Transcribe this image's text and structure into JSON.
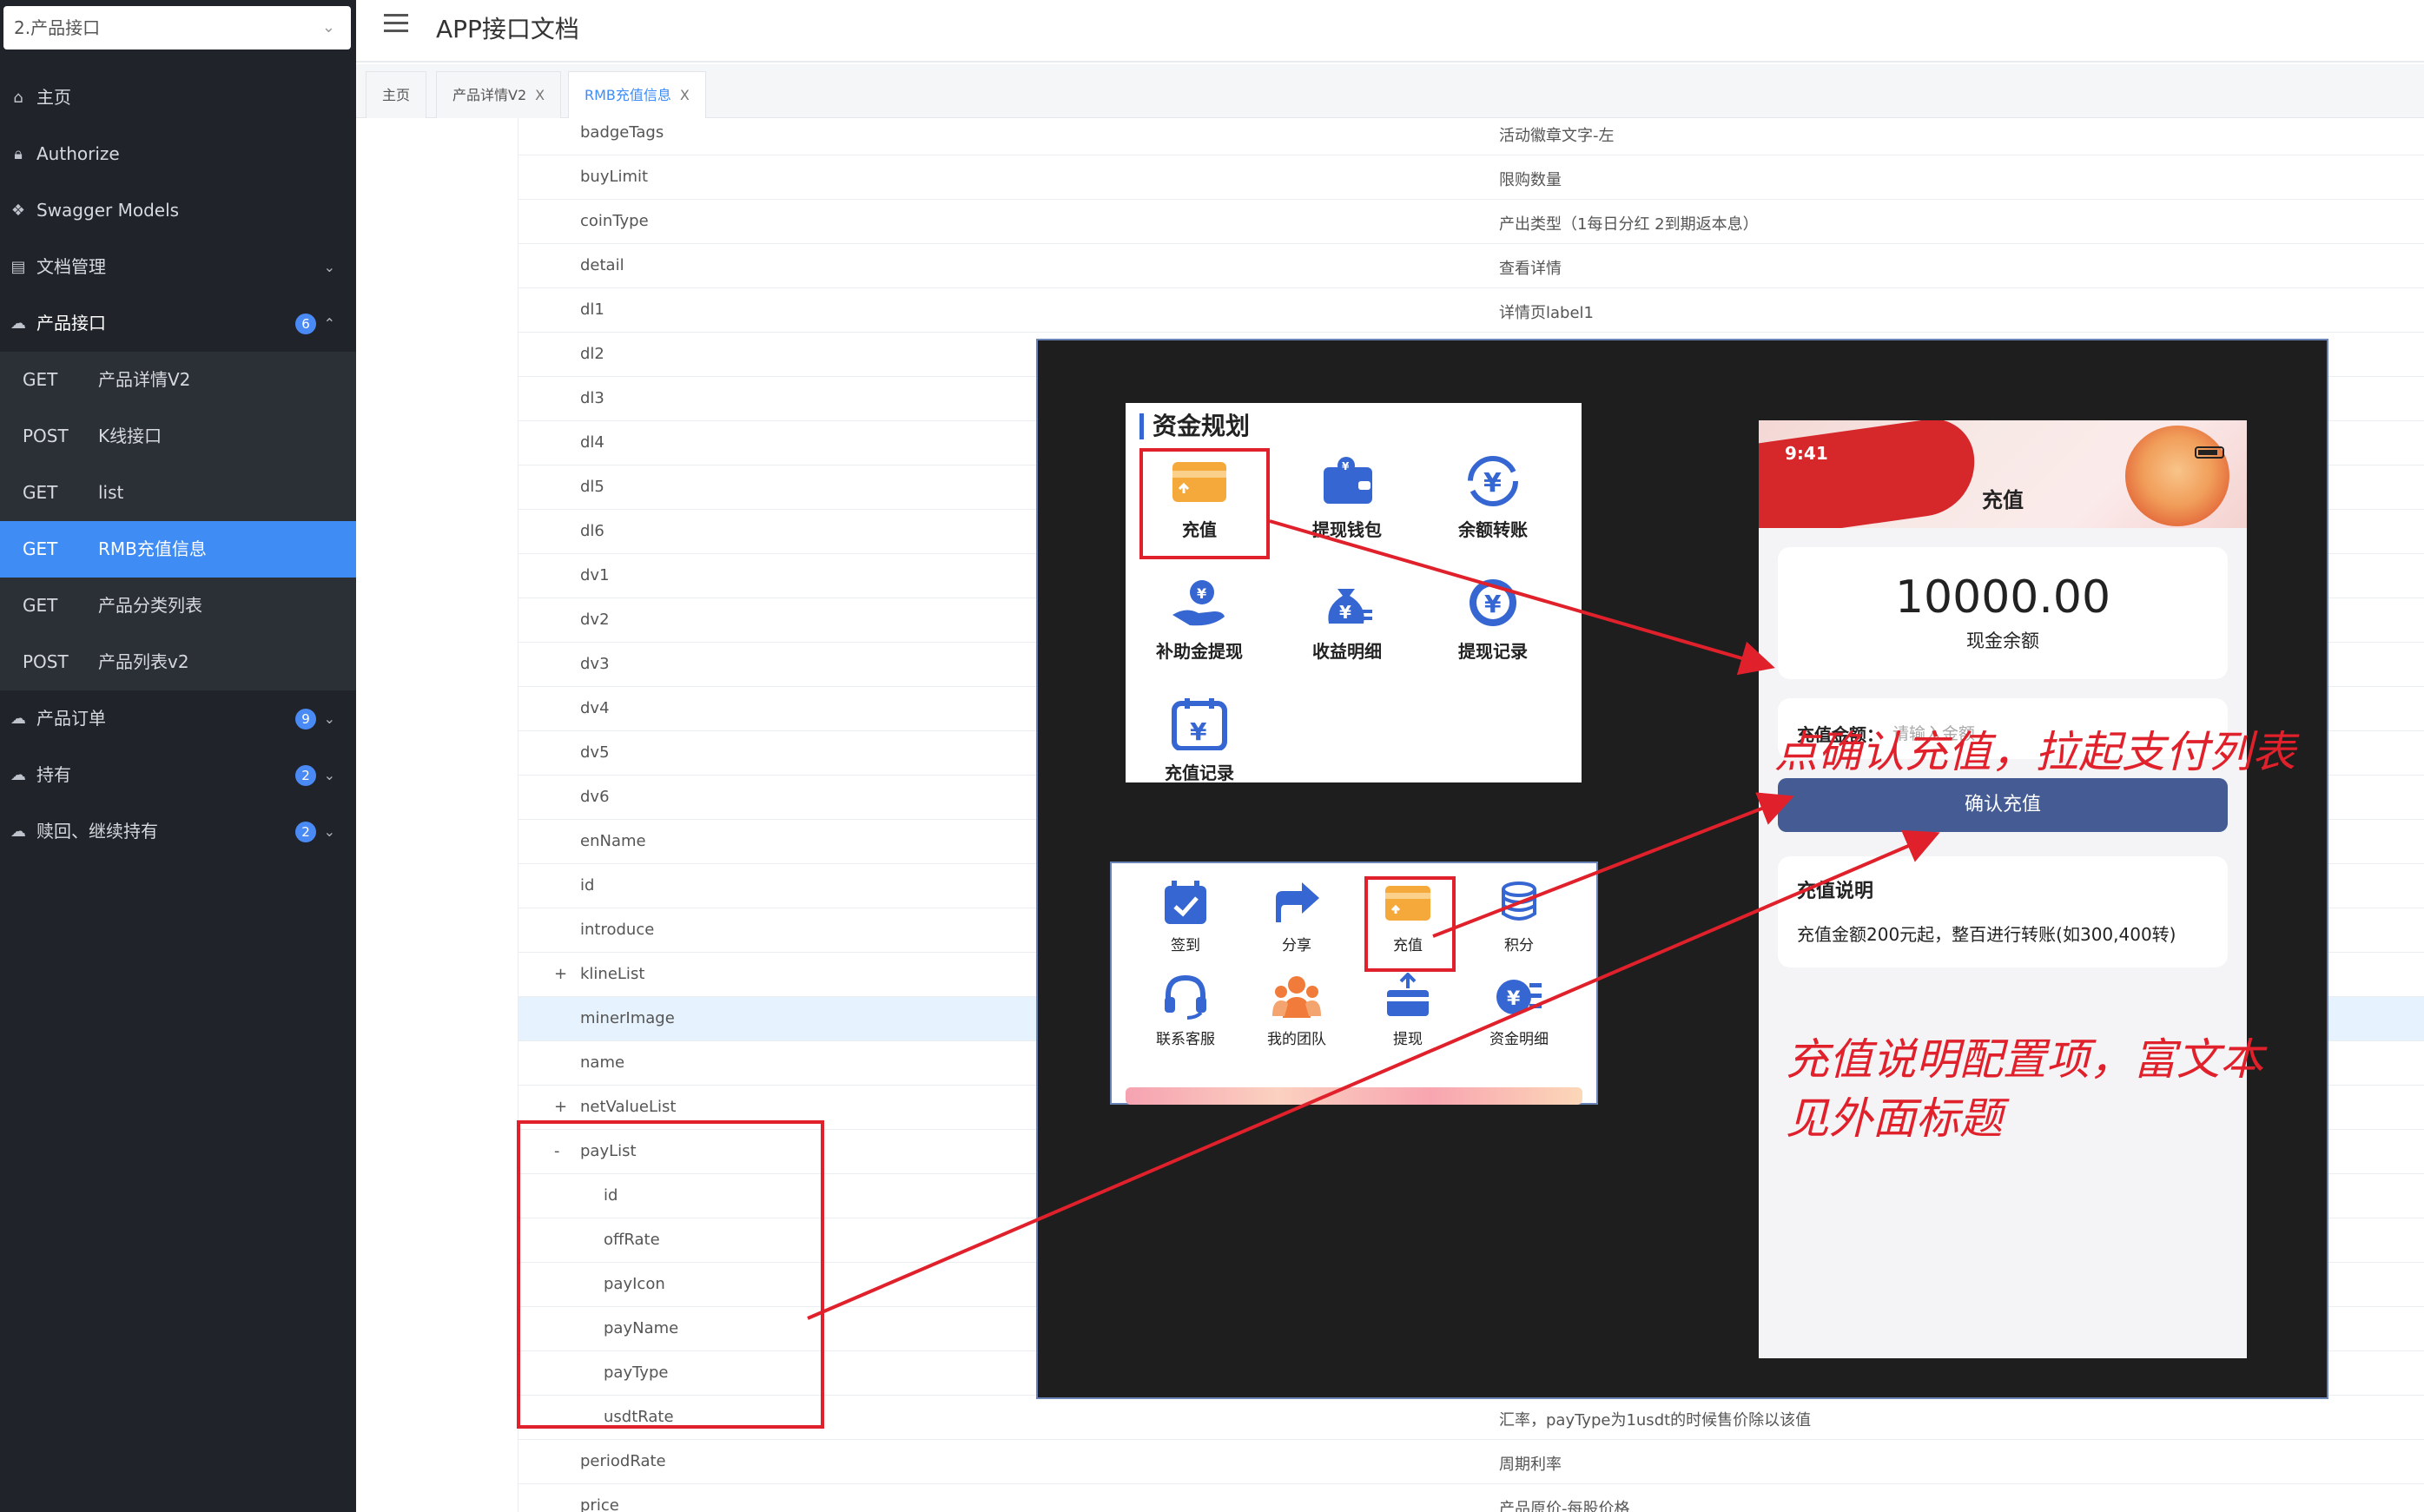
{
  "sidebar": {
    "selector": "2.产品接口",
    "items": [
      {
        "label": "主页",
        "icon": "home-icon"
      },
      {
        "label": "Authorize",
        "icon": "lock-icon"
      },
      {
        "label": "Swagger Models",
        "icon": "cube-icon"
      },
      {
        "label": "文档管理",
        "icon": "doc-icon"
      },
      {
        "label": "产品接口",
        "badge": "6",
        "icon": "cloud-icon"
      },
      {
        "label": "产品订单",
        "badge": "9",
        "icon": "cloud-icon"
      },
      {
        "label": "持有",
        "badge": "2",
        "icon": "cloud-icon"
      },
      {
        "label": "赎回、继续持有",
        "badge": "2",
        "icon": "cloud-icon"
      }
    ],
    "sub_items": [
      {
        "method": "GET",
        "label": "产品详情V2"
      },
      {
        "method": "POST",
        "label": "K线接口"
      },
      {
        "method": "GET",
        "label": "list"
      },
      {
        "method": "GET",
        "label": "RMB充值信息"
      },
      {
        "method": "GET",
        "label": "产品分类列表"
      },
      {
        "method": "POST",
        "label": "产品列表v2"
      }
    ]
  },
  "header": {
    "title": "APP接口文档"
  },
  "tabs": [
    {
      "label": "主页"
    },
    {
      "label": "产品详情V2",
      "close": "X"
    },
    {
      "label": "RMB充值信息",
      "close": "X"
    }
  ],
  "rows": [
    {
      "name": "badgeTags",
      "desc": "活动徽章文字-左",
      "toggle": ""
    },
    {
      "name": "buyLimit",
      "desc": "限购数量",
      "toggle": ""
    },
    {
      "name": "coinType",
      "desc": "产出类型（1每日分红 2到期返本息）",
      "toggle": ""
    },
    {
      "name": "detail",
      "desc": "查看详情",
      "toggle": ""
    },
    {
      "name": "dl1",
      "desc": "详情页label1",
      "toggle": ""
    },
    {
      "name": "dl2",
      "desc": "详情页label2",
      "toggle": ""
    },
    {
      "name": "dl3",
      "desc": "",
      "toggle": ""
    },
    {
      "name": "dl4",
      "desc": "",
      "toggle": ""
    },
    {
      "name": "dl5",
      "desc": "",
      "toggle": ""
    },
    {
      "name": "dl6",
      "desc": "",
      "toggle": ""
    },
    {
      "name": "dv1",
      "desc": "",
      "toggle": ""
    },
    {
      "name": "dv2",
      "desc": "",
      "toggle": ""
    },
    {
      "name": "dv3",
      "desc": "",
      "toggle": ""
    },
    {
      "name": "dv4",
      "desc": "",
      "toggle": ""
    },
    {
      "name": "dv5",
      "desc": "",
      "toggle": ""
    },
    {
      "name": "dv6",
      "desc": "",
      "toggle": ""
    },
    {
      "name": "enName",
      "desc": "",
      "toggle": ""
    },
    {
      "name": "id",
      "desc": "",
      "toggle": ""
    },
    {
      "name": "introduce",
      "desc": "",
      "toggle": ""
    },
    {
      "name": "klineList",
      "desc": "",
      "toggle": "+"
    },
    {
      "name": "minerImage",
      "desc": "",
      "toggle": ""
    },
    {
      "name": "name",
      "desc": "",
      "toggle": ""
    },
    {
      "name": "netValueList",
      "desc": "",
      "toggle": "+"
    },
    {
      "name": "payList",
      "desc": "",
      "toggle": "-"
    },
    {
      "name": "id",
      "desc": "",
      "toggle": ""
    },
    {
      "name": "offRate",
      "desc": "",
      "toggle": ""
    },
    {
      "name": "payIcon",
      "desc": "",
      "toggle": ""
    },
    {
      "name": "payName",
      "desc": "",
      "toggle": ""
    },
    {
      "name": "payType",
      "desc": "",
      "toggle": ""
    },
    {
      "name": "usdtRate",
      "desc": "汇率，payType为1usdt的时候售价除以该值",
      "toggle": ""
    },
    {
      "name": "periodRate",
      "desc": "周期利率",
      "toggle": ""
    },
    {
      "name": "price",
      "desc": "产品原价-每股价格",
      "toggle": ""
    }
  ],
  "card1": {
    "title": "资金规划",
    "items": [
      {
        "label": "充值",
        "icon": "recharge-card-icon"
      },
      {
        "label": "提现钱包",
        "icon": "wallet-icon"
      },
      {
        "label": "余额转账",
        "icon": "transfer-icon"
      },
      {
        "label": "补助金提现",
        "icon": "hand-coin-icon"
      },
      {
        "label": "收益明细",
        "icon": "money-bag-icon"
      },
      {
        "label": "提现记录",
        "icon": "coin-record-icon"
      },
      {
        "label": "充值记录",
        "icon": "calendar-coin-icon"
      }
    ]
  },
  "card2": {
    "items": [
      {
        "label": "签到",
        "icon": "checkin-icon"
      },
      {
        "label": "分享",
        "icon": "share-icon"
      },
      {
        "label": "充值",
        "icon": "recharge-card-icon"
      },
      {
        "label": "积分",
        "icon": "coins-icon"
      },
      {
        "label": "联系客服",
        "icon": "headset-icon"
      },
      {
        "label": "我的团队",
        "icon": "team-icon"
      },
      {
        "label": "提现",
        "icon": "withdraw-icon"
      },
      {
        "label": "资金明细",
        "icon": "fund-detail-icon"
      }
    ]
  },
  "phone": {
    "time": "9:41",
    "title": "充值",
    "balance": "10000.00",
    "balance_label": "现金余额",
    "amount_label": "充值金额：",
    "amount_placeholder": "请输入金额",
    "confirm": "确认充值",
    "desc_title": "充值说明",
    "desc_text": "充值金额200元起，整百进行转账(如300,400转)"
  },
  "annotations": {
    "a1": "点确认充值，拉起支付列表",
    "a2_line1": "充值说明配置项，富文本",
    "a2_line2": "见外面标题"
  },
  "colors": {
    "accent": "#3f8cf5",
    "sidebar_bg": "#20232a",
    "annotation_red": "#e0202a",
    "confirm_btn": "#445c93"
  }
}
